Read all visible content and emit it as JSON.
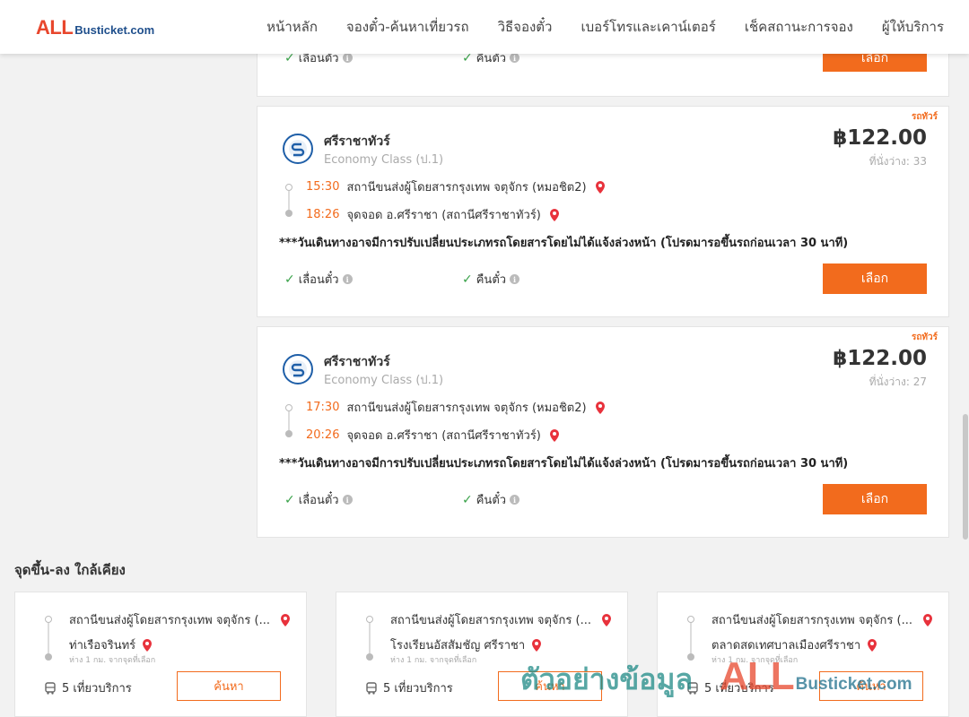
{
  "header": {
    "logo_all": "ALL",
    "logo_rest": "Busticket.com",
    "nav": [
      "หน้าหลัก",
      "จองตั๋ว-ค้นหาเที่ยวรถ",
      "วิธีจองตั๋ว",
      "เบอร์โทรและเคาน์เตอร์",
      "เช็คสถานะการจอง",
      "ผู้ให้บริการ"
    ]
  },
  "top_card": {
    "feature_1": "เลื่อนตั๋ว",
    "feature_2": "คืนตั๋ว",
    "button": "เลือก"
  },
  "trips": [
    {
      "tag": "รถทัวร์",
      "operator": "ศรีราชาทัวร์",
      "class": "Economy Class (ป.1)",
      "price": "฿122.00",
      "seats": "ที่นั่งว่าง: 33",
      "depart_time": "15:30",
      "depart_place": "สถานีขนส่งผู้โดยสารกรุงเทพ จตุจักร (หมอชิต2)",
      "arrive_time": "18:26",
      "arrive_place": "จุดจอด อ.ศรีราชา (สถานีศรีราชาทัวร์)",
      "note": "***วันเดินทางอาจมีการปรับเปลี่ยนประเภทรถโดยสารโดยไม่ได้แจ้งล่วงหน้า (โปรดมารอขึ้นรถก่อนเวลา 30 นาที)",
      "feature_1": "เลื่อนตั๋ว",
      "feature_2": "คืนตั๋ว",
      "button": "เลือก"
    },
    {
      "tag": "รถทัวร์",
      "operator": "ศรีราชาทัวร์",
      "class": "Economy Class (ป.1)",
      "price": "฿122.00",
      "seats": "ที่นั่งว่าง: 27",
      "depart_time": "17:30",
      "depart_place": "สถานีขนส่งผู้โดยสารกรุงเทพ จตุจักร (หมอชิต2)",
      "arrive_time": "20:26",
      "arrive_place": "จุดจอด อ.ศรีราชา (สถานีศรีราชาทัวร์)",
      "note": "***วันเดินทางอาจมีการปรับเปลี่ยนประเภทรถโดยสารโดยไม่ได้แจ้งล่วงหน้า (โปรดมารอขึ้นรถก่อนเวลา 30 นาที)",
      "feature_1": "เลื่อนตั๋ว",
      "feature_2": "คืนตั๋ว",
      "button": "เลือก"
    }
  ],
  "nearby": {
    "title": "จุดขึ้น-ลง ใกล้เคียง",
    "cards": [
      {
        "from": "สถานีขนส่งผู้โดยสารกรุงเทพ จตุจักร (...",
        "to": "ท่าเรือจรินทร์",
        "distance": "ห่าง 1 กม. จากจุดที่เลือก",
        "trips": "5 เที่ยวบริการ",
        "button": "ค้นหา"
      },
      {
        "from": "สถานีขนส่งผู้โดยสารกรุงเทพ จตุจักร (...",
        "to": "โรงเรียนอัสสัมชัญ ศรีราชา",
        "distance": "ห่าง 1 กม. จากจุดที่เลือก",
        "trips": "5 เที่ยวบริการ",
        "button": "ค้นหา"
      },
      {
        "from": "สถานีขนส่งผู้โดยสารกรุงเทพ จตุจักร (...",
        "to": "ตลาดสดเทศบาลเมืองศรีราชา",
        "distance": "ห่าง 1 กม. จากจุดที่เลือก",
        "trips": "5 เที่ยวบริการ",
        "button": "ค้นหา"
      }
    ]
  },
  "watermark": {
    "text": "ตัวอย่างข้อมูล",
    "all": "ALL",
    "rest": "Busticket.com"
  },
  "colors": {
    "accent": "#f26b1d",
    "check": "#3aa24a",
    "pin": "#e8323c",
    "brand_red": "#e8472d",
    "brand_blue": "#1f4f8c"
  }
}
